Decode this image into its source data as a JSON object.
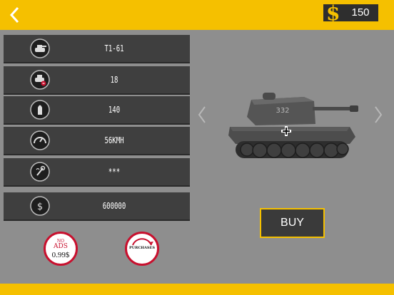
{
  "header": {
    "back_icon": "chevron-left-icon",
    "currency_symbol": "$",
    "coins": "150"
  },
  "stats": [
    {
      "icon": "tank-icon",
      "value": "T1-61"
    },
    {
      "icon": "tank-damage-icon",
      "value": "18"
    },
    {
      "icon": "shell-icon",
      "value": "140"
    },
    {
      "icon": "speedometer-icon",
      "value": "56KMH"
    },
    {
      "icon": "repair-icon",
      "value": "***"
    },
    {
      "icon": "dollar-icon",
      "value": "600000"
    }
  ],
  "tank": {
    "turret_number": "332"
  },
  "buy_label": "BUY",
  "no_ads": {
    "line1": "NO",
    "line2": "ADS",
    "price": "0.99$"
  },
  "purchases_label": "PURCHASES",
  "colors": {
    "accent": "#f5c000",
    "panel": "#3f3f3f",
    "background": "#8e8e8e",
    "badge_red": "#c8102e"
  }
}
